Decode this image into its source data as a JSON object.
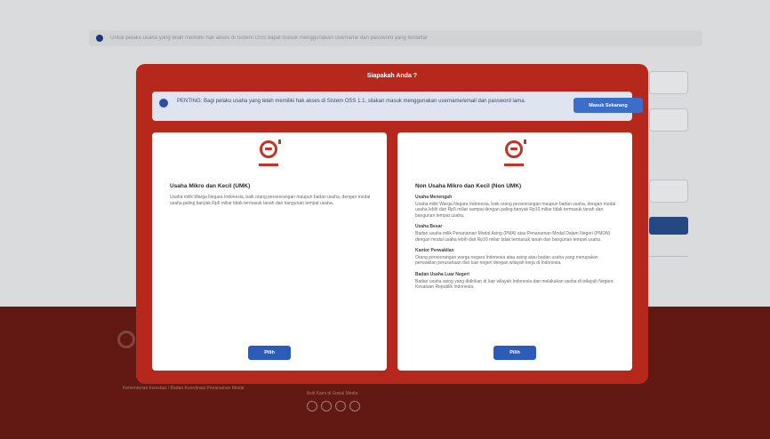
{
  "background": {
    "notice_text": "Untuk pelaku usaha yang telah memiliki hak akses di Sistem OSS dapat masuk menggunakan username dan password yang terdaftar",
    "footer_text_1": "Kementerian Investasi / Badan Koordinasi Penanaman Modal",
    "footer_text_2": "Ikuti Kami di Sosial Media"
  },
  "modal": {
    "title": "Siapakah Anda ?",
    "info": {
      "text": "PENTING: Bagi pelaku usaha yang telah memiliki hak akses di Sistem OSS 1.1, silakan masuk menggunakan username/email dan password lama.",
      "button_label": "Masuk Sekarang"
    },
    "cards": [
      {
        "title": "Usaha Mikro dan Kecil (UMK)",
        "paragraphs": [
          {
            "heading": "",
            "text": "Usaha milik Warga Negara Indonesia, baik orang perseorangan maupun badan usaha, dengan modal usaha paling banyak Rp5 miliar tidak termasuk tanah dan bangunan tempat usaha."
          }
        ],
        "button_label": "Pilih"
      },
      {
        "title": "Non Usaha Mikro dan Kecil (Non UMK)",
        "paragraphs": [
          {
            "heading": "Usaha Menengah",
            "text": "Usaha milik Warga Negara Indonesia, baik orang perseorangan maupun badan usaha, dengan modal usaha lebih dari Rp5 miliar sampai dengan paling banyak Rp10 miliar tidak termasuk tanah dan bangunan tempat usaha."
          },
          {
            "heading": "Usaha Besar",
            "text": "Badan usaha milik Penanaman Modal Asing (PMA) atau Penanaman Modal Dalam Negeri (PMDN) dengan modal usaha lebih dari Rp10 miliar tidak termasuk tanah dan bangunan tempat usaha."
          },
          {
            "heading": "Kantor Perwakilan",
            "text": "Orang perseorangan warga negara Indonesia atau asing atau badan usaha yang merupakan perwakilan perusahaan dari luar negeri dengan wilayah kerja di Indonesia."
          },
          {
            "heading": "Badan Usaha Luar Negeri",
            "text": "Badan usaha asing yang didirikan di luar wilayah Indonesia dan melakukan usaha di wilayah Negara Kesatuan Republik Indonesia."
          }
        ],
        "button_label": "Pilih"
      }
    ]
  },
  "colors": {
    "modal_red": "#b6281c",
    "button_blue": "#2d5cb8",
    "footer_maroon": "#6b1b15"
  }
}
